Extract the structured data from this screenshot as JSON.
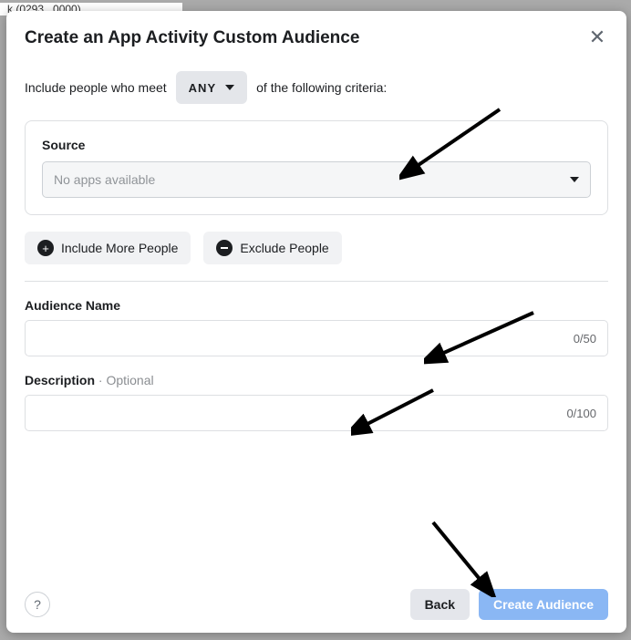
{
  "backdrop": {
    "truncated_label": "k (0293...0000)"
  },
  "modal": {
    "title": "Create an App Activity Custom Audience",
    "criteria_prefix": "Include people who meet",
    "criteria_mode": "ANY",
    "criteria_suffix": "of the following criteria:",
    "source": {
      "label": "Source",
      "placeholder": "No apps available"
    },
    "include_more_label": "Include More People",
    "exclude_label": "Exclude People",
    "audience_name": {
      "label": "Audience Name",
      "counter": "0/50"
    },
    "description": {
      "label": "Description",
      "optional": " · Optional",
      "counter": "0/100"
    }
  },
  "footer": {
    "help_glyph": "?",
    "back_label": "Back",
    "create_label": "Create Audience"
  }
}
